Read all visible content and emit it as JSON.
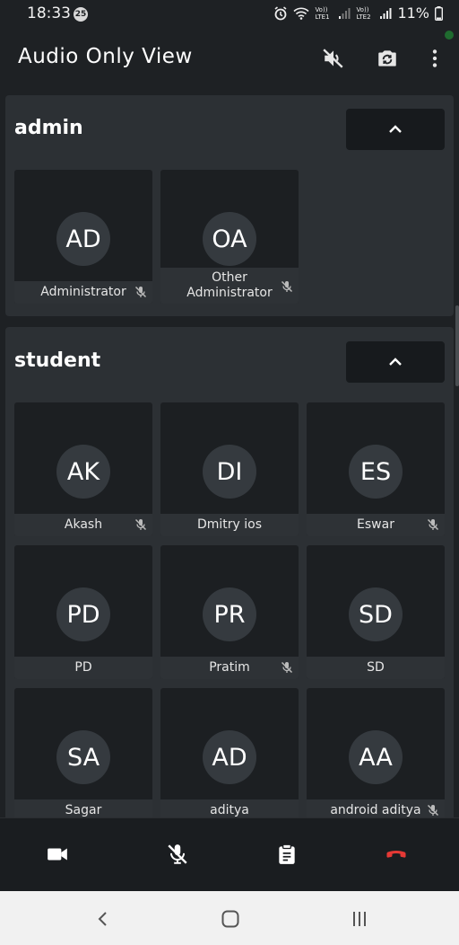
{
  "status": {
    "time": "18:33",
    "badge": "25",
    "sim1": "Vo)) LTE1",
    "sim2": "Vo)) LTE2",
    "battery": "11%"
  },
  "app_bar": {
    "title": "Audio Only View",
    "icons": [
      "volume-off-icon",
      "switch-camera-icon",
      "more-vert-icon"
    ]
  },
  "sections": [
    {
      "title": "admin",
      "participants": [
        {
          "initials": "AD",
          "name": "Administrator",
          "muted": true
        },
        {
          "initials": "OA",
          "name": "Other Administrator",
          "muted": true
        }
      ]
    },
    {
      "title": "student",
      "participants": [
        {
          "initials": "AK",
          "name": "Akash",
          "muted": true
        },
        {
          "initials": "DI",
          "name": "Dmitry ios",
          "muted": false
        },
        {
          "initials": "ES",
          "name": "Eswar",
          "muted": true
        },
        {
          "initials": "PD",
          "name": "PD",
          "muted": false
        },
        {
          "initials": "PR",
          "name": "Pratim",
          "muted": true
        },
        {
          "initials": "SD",
          "name": "SD",
          "muted": false
        },
        {
          "initials": "SA",
          "name": "Sagar",
          "muted": false
        },
        {
          "initials": "AD",
          "name": "aditya",
          "muted": false
        },
        {
          "initials": "AA",
          "name": "android aditya",
          "muted": true
        }
      ]
    }
  ],
  "bottom_bar": {
    "icons": [
      "video-camera-icon",
      "mic-off-icon",
      "clipboard-icon",
      "end-call-icon"
    ],
    "end_call_color": "#e53935"
  },
  "nav_bar": {
    "icons": [
      "back-icon",
      "home-icon",
      "recents-icon"
    ]
  }
}
